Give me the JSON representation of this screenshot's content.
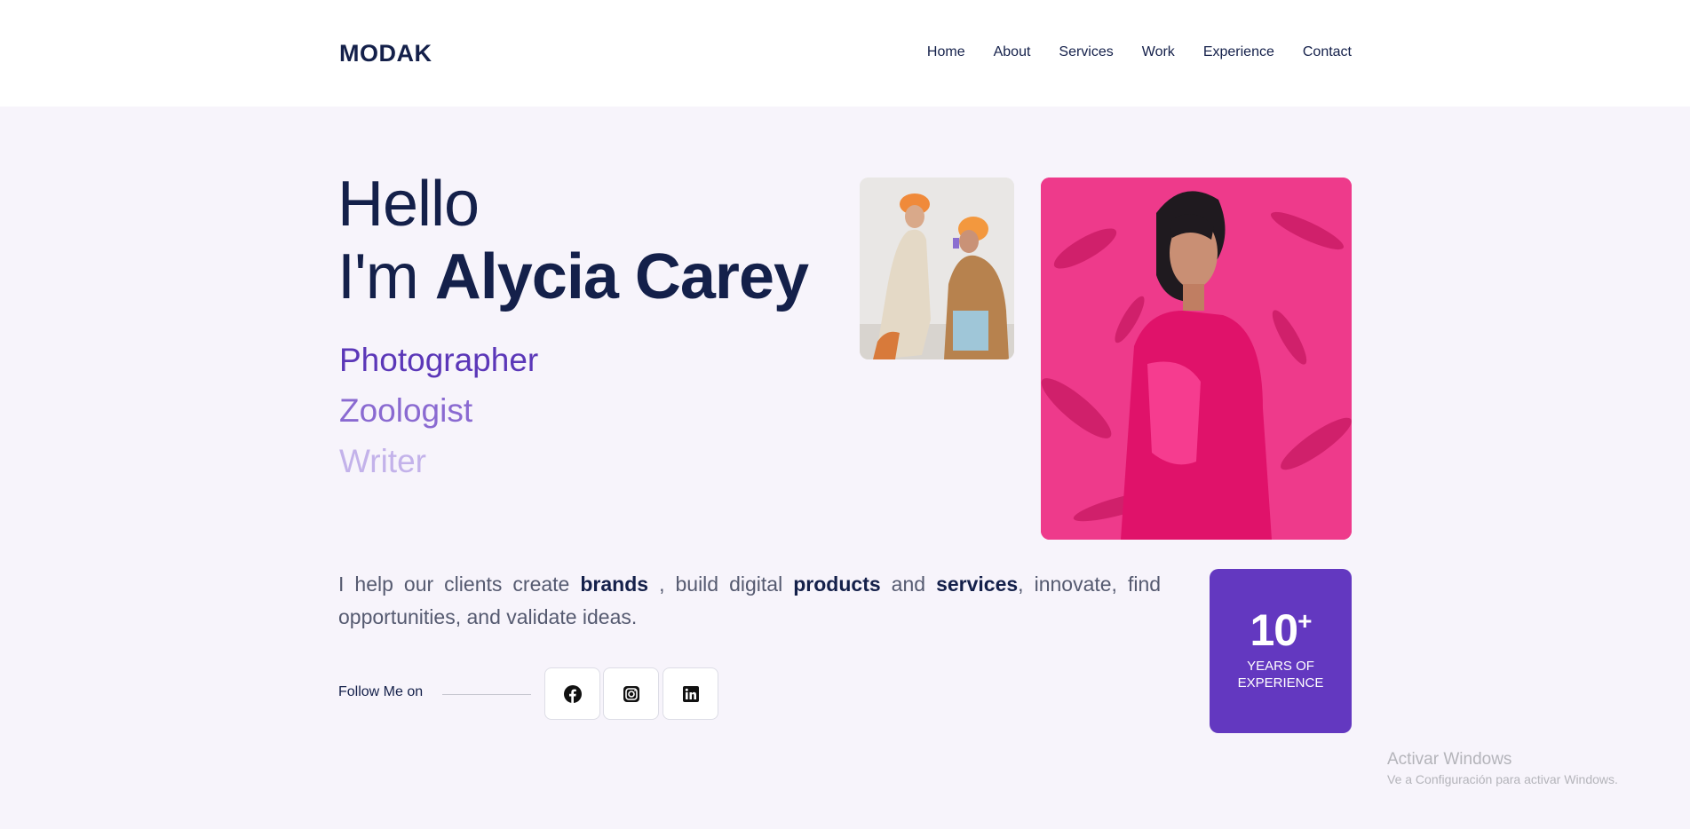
{
  "header": {
    "logo": "MODAK",
    "nav": [
      "Home",
      "About",
      "Services",
      "Work",
      "Experience",
      "Contact"
    ]
  },
  "hero": {
    "greeting": "Hello",
    "intro": "I'm",
    "name": "Alycia Carey",
    "roles": [
      "Photographer",
      "Zoologist",
      "Writer"
    ],
    "description": {
      "p1": "I help our clients create",
      "b1": "brands",
      "p2": ", build digital",
      "b2": "products",
      "p3": "and",
      "b3": "services",
      "p4": ", innovate, find opportunities, and validate ideas."
    },
    "follow_label": "Follow Me on",
    "social_icons": [
      "facebook-icon",
      "instagram-icon",
      "linkedin-icon"
    ]
  },
  "experience": {
    "number": "10",
    "plus": "+",
    "label_line1": "YEARS OF",
    "label_line2": "EXPERIENCE"
  },
  "watermark": {
    "line1": "Activar Windows",
    "line2": "Ve a Configuración para activar Windows."
  },
  "colors": {
    "navy": "#14204a",
    "purple": "#6338c0",
    "background": "#f7f4fb"
  }
}
